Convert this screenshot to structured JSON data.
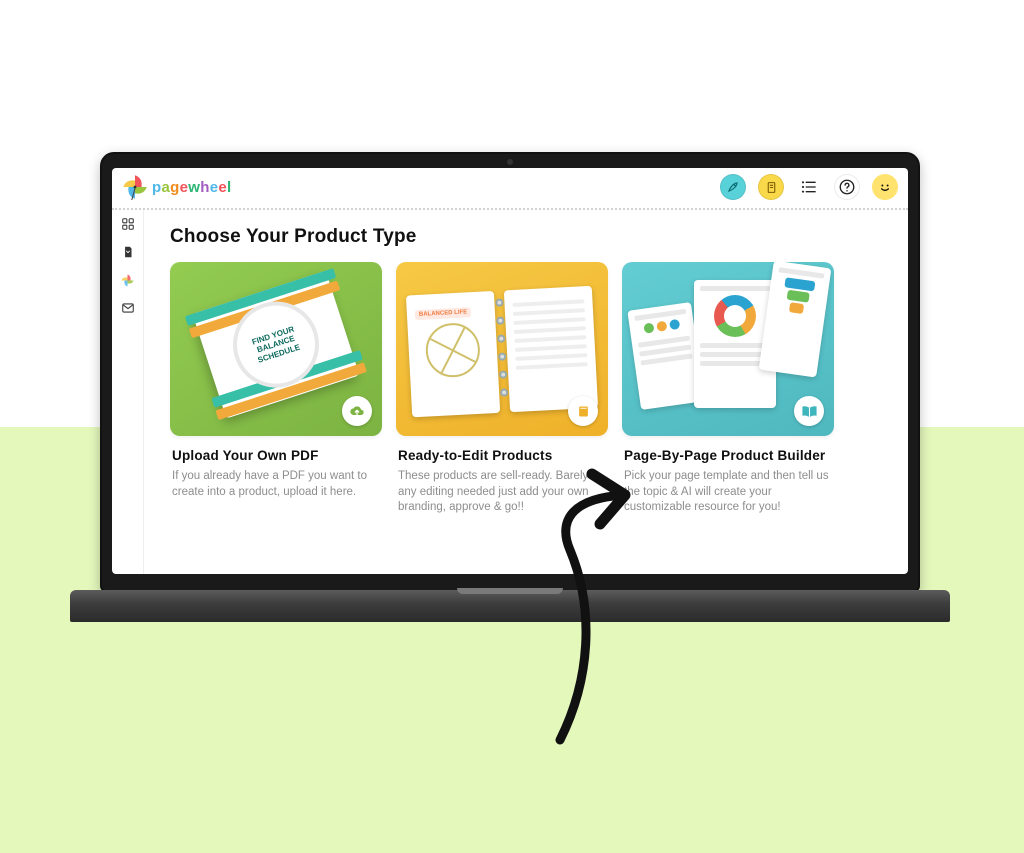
{
  "brand": "pagewheel",
  "page_title": "Choose Your Product Type",
  "cards": [
    {
      "title": "Upload Your Own PDF",
      "desc": "If you already have a PDF you want to create into a product, upload it here.",
      "book_label": "FIND YOUR BALANCE SCHEDULE",
      "badge_icon": "cloud-upload-icon",
      "bg": "green"
    },
    {
      "title": "Ready-to-Edit Products",
      "desc": "These products are sell-ready. Barely any editing needed just add your own branding, approve & go!!",
      "binder_tag": "BALANCED LIFE",
      "badge_icon": "book-icon",
      "bg": "yellow"
    },
    {
      "title": "Page-By-Page Product Builder",
      "desc": "Pick your page template and then tell us the topic & AI will create your customizable resource for you!",
      "badge_icon": "open-book-icon",
      "bg": "cyan"
    }
  ],
  "header_icons": {
    "rocket": "rocket-icon",
    "document": "document-icon",
    "list": "list-icon",
    "help": "help-icon",
    "smile": "smile-icon"
  },
  "sidenav": {
    "grid": "grid-icon",
    "page": "page-icon",
    "brand": "pinwheel-icon",
    "mail": "mail-icon"
  }
}
